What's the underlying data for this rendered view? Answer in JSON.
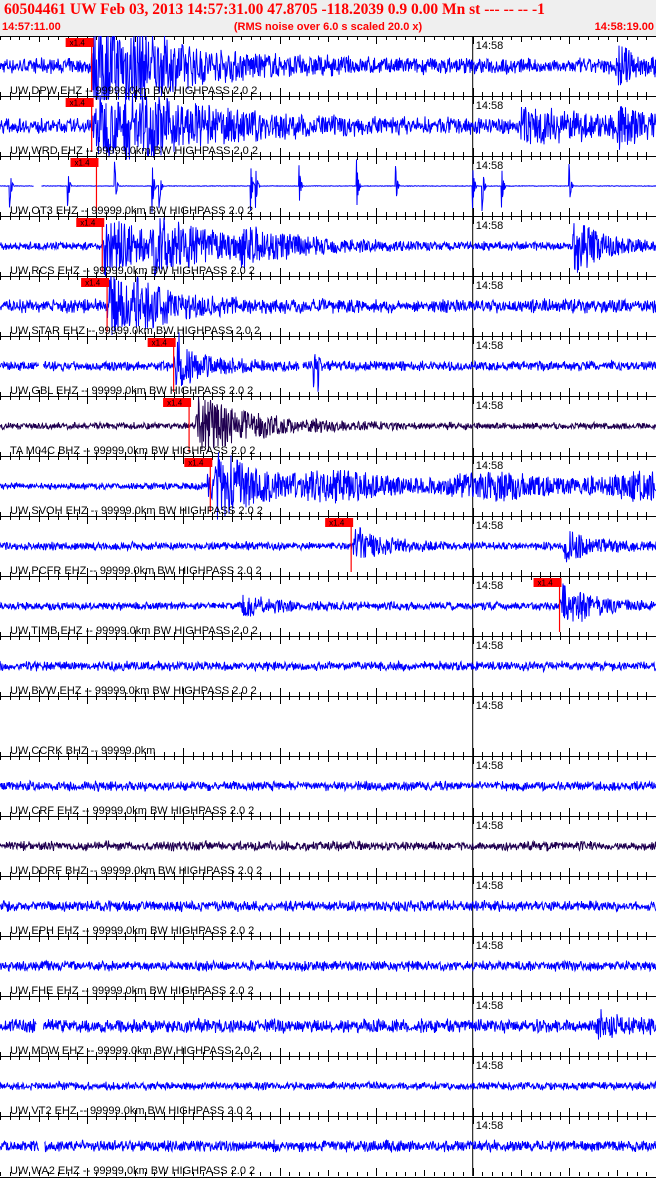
{
  "header": {
    "title": "60504461 UW Feb 03, 2013 14:57:31.00   47.8705 -118.2039  0.9 0.00 Mn st --- -- --  -1",
    "subtitle": "(RMS noise over 6.0 s scaled 20.0 x)",
    "start_time": "14:57:11.00",
    "end_time": "14:58:19.00"
  },
  "colors": {
    "header_text": "#ff0000",
    "trace_blue": "#0000ff",
    "trace_dark": "#200050",
    "pick": "#ff0000",
    "axis": "#000000"
  },
  "chart_data": {
    "type": "line",
    "title": "60504461 UW Feb 03, 2013 14:57:31.00   47.8705 -118.2039  0.9 0.00 Mn st --- -- --  -1",
    "subtitle": "(RMS noise over 6.0 s scaled 20.0 x)",
    "x_range": [
      "14:57:11.00",
      "14:58:19.00"
    ],
    "minute_tick_label": "14:58",
    "pick_label": "x1.4",
    "traces": [
      {
        "label": "UW DPW EHZ --  99999.0km BW  HIGHPASS  2.0  2",
        "color": "blue",
        "pick_s": 9.5,
        "noise": 0.22,
        "bursts": [
          [
            9.6,
            1.0,
            6
          ],
          [
            10.0,
            0.8,
            4
          ],
          [
            13.0,
            0.5,
            12
          ],
          [
            64.0,
            0.7,
            2
          ]
        ]
      },
      {
        "label": "UW WRD EHZ --  99999.0km BW  HIGHPASS  2.0  2",
        "color": "blue",
        "pick_s": 9.5,
        "noise": 0.22,
        "bursts": [
          [
            9.8,
            1.0,
            8
          ],
          [
            13.0,
            0.5,
            12
          ],
          [
            54.0,
            0.5,
            10
          ],
          [
            64.0,
            0.6,
            2
          ]
        ]
      },
      {
        "label": "UW OT3 EHZ --  99999.0km BW  HIGHPASS  2.0  2",
        "color": "blue",
        "pick_s": 10.0,
        "style": "spikes",
        "gaps": [
          [
            3.5,
            4.3
          ]
        ],
        "spikes": [
          1.0,
          7.0,
          11.9,
          15.8,
          16.5,
          26.0,
          26.5,
          31.0,
          37.0,
          41.0,
          49.0,
          50.0,
          52.0,
          59.0
        ]
      },
      {
        "label": "UW RCS EHZ --  99999.0km BW  HIGHPASS  2.0  2",
        "color": "blue",
        "pick_s": 10.6,
        "noise": 0.12,
        "bursts": [
          [
            10.8,
            1.0,
            6
          ],
          [
            16.0,
            0.6,
            8
          ],
          [
            25.0,
            0.4,
            6
          ],
          [
            59.5,
            1.0,
            3
          ]
        ]
      },
      {
        "label": "UW STAR EHZ --  99999.0km BW  HIGHPASS  2.0  2",
        "color": "blue",
        "pick_s": 11.1,
        "noise": 0.2,
        "bursts": [
          [
            11.3,
            1.0,
            4
          ],
          [
            14.0,
            0.4,
            6
          ]
        ]
      },
      {
        "label": "UW GBL EHZ --  99999.0km BW  HIGHPASS  2.0  2",
        "color": "blue",
        "pick_s": 18.0,
        "noise": 0.15,
        "gaps": [
          [
            4.0,
            4.5
          ],
          [
            31.0,
            31.4
          ]
        ],
        "spikes": [
          18.5,
          32.5,
          33.0
        ],
        "bursts": [
          [
            18.2,
            0.8,
            3
          ]
        ]
      },
      {
        "label": "TA M04C BHZ --  99999.0km BW  HIGHPASS  2.0  2",
        "color": "dark",
        "pick_s": 19.6,
        "noise": 0.1,
        "bursts": [
          [
            20.5,
            1.0,
            6
          ]
        ]
      },
      {
        "label": "UW SVOH EHZ --  99999.0km BW  HIGHPASS  2.0  2",
        "color": "blue",
        "pick_s": 21.8,
        "noise": 0.1,
        "bursts": [
          [
            22.5,
            1.0,
            4
          ]
        ],
        "swarm_from_s": 21.5
      },
      {
        "label": "UW PCFR EHZ --  99999.0km BW  HIGHPASS  2.0  2",
        "color": "blue",
        "pick_s": 36.4,
        "noise": 0.12,
        "bursts": [
          [
            36.8,
            0.6,
            3
          ],
          [
            58.5,
            0.5,
            3
          ]
        ]
      },
      {
        "label": "UW TIMB EHZ --  99999.0km BW  HIGHPASS  2.0  2",
        "color": "blue",
        "pick_s": 58.0,
        "noise": 0.12,
        "bursts": [
          [
            25.0,
            0.3,
            4
          ],
          [
            58.3,
            0.8,
            3
          ]
        ]
      },
      {
        "label": "UW BVW EHZ --  99999.0km BW  HIGHPASS  2.0  2",
        "color": "blue",
        "noise": 0.14
      },
      {
        "label": "UW CCRK BHZ --  99999.0km",
        "color": "none"
      },
      {
        "label": "UW CRF EHZ --  99999.0km BW  HIGHPASS  2.0  2",
        "color": "blue",
        "noise": 0.14
      },
      {
        "label": "UW DDRF BHZ --  99999.0km BW  HIGHPASS  2.0  2",
        "color": "dark",
        "noise": 0.14
      },
      {
        "label": "UW EPH EHZ --  99999.0km BW  HIGHPASS  2.0  2",
        "color": "blue",
        "noise": 0.16
      },
      {
        "label": "UW FHE EHZ --  99999.0km BW  HIGHPASS  2.0  2",
        "color": "blue",
        "noise": 0.15
      },
      {
        "label": "UW MDW EHZ --  99999.0km BW  HIGHPASS  2.0  2",
        "color": "blue",
        "noise": 0.2,
        "gaps": [
          [
            3.8,
            4.5
          ]
        ],
        "bursts": [
          [
            62.0,
            0.4,
            3
          ]
        ]
      },
      {
        "label": "UW VT2 EHZ --  99999.0km BW  HIGHPASS  2.0  2",
        "color": "blue",
        "noise": 0.12
      },
      {
        "label": "UW WA2 EHZ --  99999.0km BW  HIGHPASS  2.0  2",
        "color": "blue",
        "noise": 0.17,
        "gaps": [
          [
            4.0,
            4.6
          ]
        ]
      }
    ]
  }
}
